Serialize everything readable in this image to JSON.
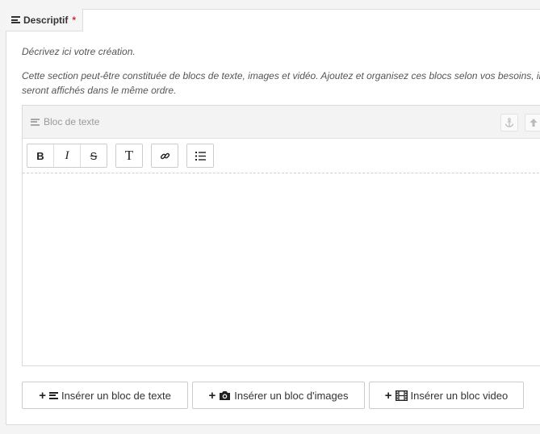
{
  "section": {
    "tab_label": "Descriptif",
    "required_mark": "*",
    "help_1": "Décrivez ici votre création.",
    "help_2": "Cette section peut-être constituée de blocs de texte, images et vidéo. Ajoutez et organisez ces blocs selon vos besoins, ils seront affichés dans le même ordre."
  },
  "text_block": {
    "title": "Bloc de texte",
    "anchor_icon": "anchor-icon",
    "move_up_icon": "arrow-up-icon",
    "toolbar": {
      "bold": "B",
      "italic": "I",
      "strike": "S",
      "heading": "T",
      "link_icon": "link-icon",
      "list_icon": "list-icon"
    }
  },
  "insert_buttons": {
    "text": "Insérer un bloc de texte",
    "images": "Insérer un bloc d'images",
    "video": "Insérer un bloc video"
  }
}
